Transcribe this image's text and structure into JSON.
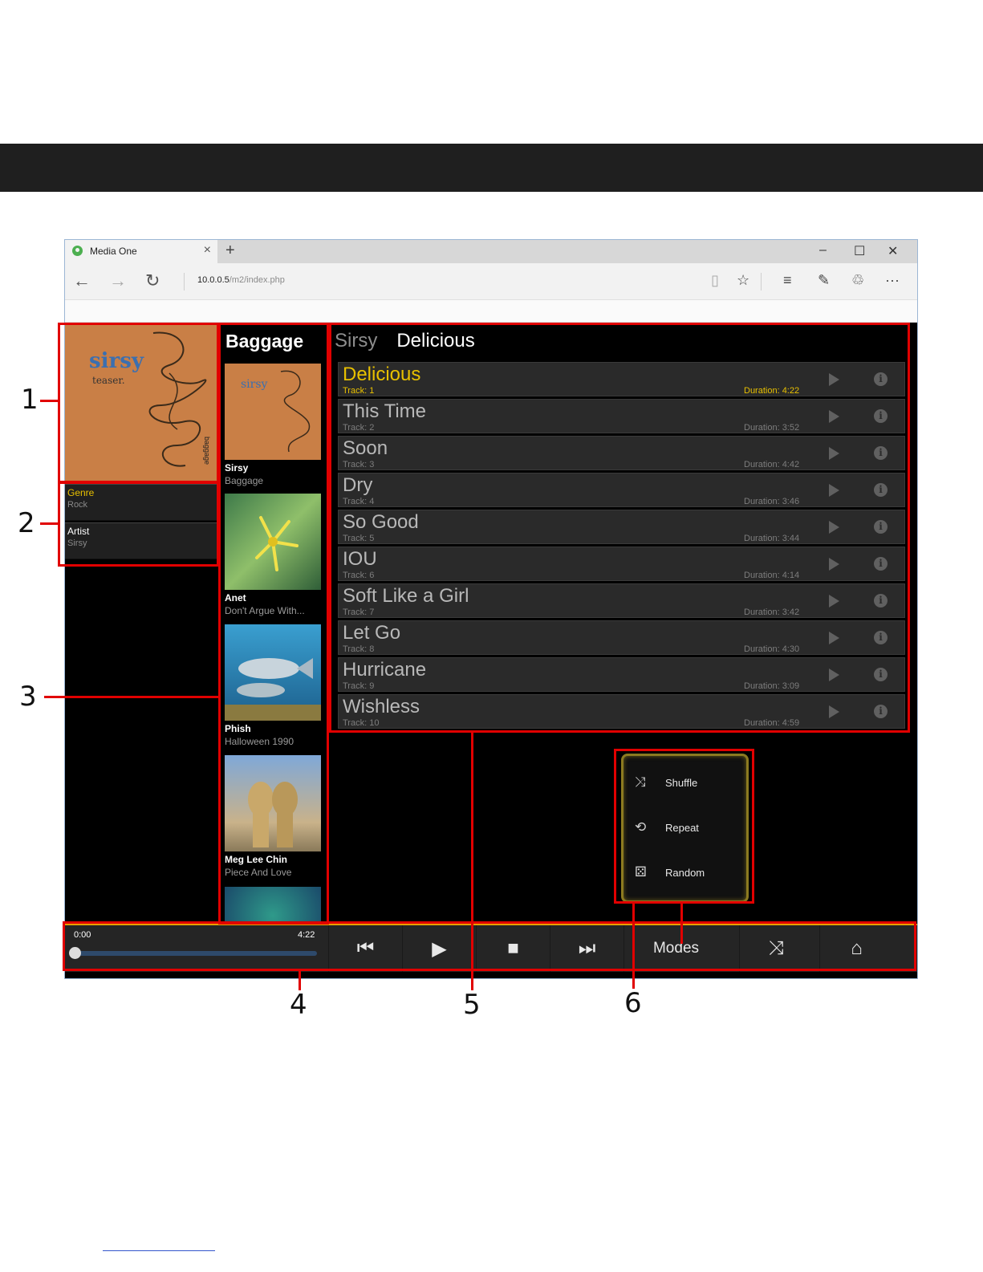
{
  "browser": {
    "tab_title": "Media One",
    "close_glyph": "×",
    "new_tab_glyph": "+",
    "url_host": "10.0.0.5",
    "url_path": "/m2/index.php",
    "window_controls": {
      "minimize": "–",
      "maximize": "☐",
      "close": "✕"
    },
    "nav": {
      "back": "←",
      "forward": "→",
      "refresh": "↻"
    },
    "toolbar_icons": {
      "reading": "▯",
      "favorite": "☆",
      "hub": "≡",
      "note": "✎",
      "share": "♲",
      "more": "···"
    }
  },
  "now_playing": {
    "album_art_text": {
      "band": "sirsy",
      "subtitle": "teaser.",
      "vertical": "baggage"
    },
    "meta": [
      {
        "label": "Genre",
        "value": "Rock",
        "label_color": "#e8c000"
      },
      {
        "label": "Artist",
        "value": "Sirsy",
        "label_color": "#ffffff"
      }
    ]
  },
  "albums": {
    "heading": "Baggage",
    "items": [
      {
        "artist": "Sirsy",
        "album": "Baggage",
        "cover": "sirsy-cover"
      },
      {
        "artist": "Anet",
        "album": "Don't Argue With...",
        "cover": "flower-cover"
      },
      {
        "artist": "Phish",
        "album": "Halloween 1990",
        "cover": "fish-cover"
      },
      {
        "artist": "Meg Lee Chin",
        "album": "Piece And Love",
        "cover": "cheetah-cover"
      }
    ]
  },
  "breadcrumb": {
    "artist": "Sirsy",
    "album": "Delicious"
  },
  "tracks": [
    {
      "title": "Delicious",
      "track": "Track: 1",
      "duration": "Duration: 4:22",
      "active": true
    },
    {
      "title": "This Time",
      "track": "Track: 2",
      "duration": "Duration: 3:52"
    },
    {
      "title": "Soon",
      "track": "Track: 3",
      "duration": "Duration: 4:42"
    },
    {
      "title": "Dry",
      "track": "Track: 4",
      "duration": "Duration: 3:46"
    },
    {
      "title": "So Good",
      "track": "Track: 5",
      "duration": "Duration: 3:44"
    },
    {
      "title": "IOU",
      "track": "Track: 6",
      "duration": "Duration: 4:14"
    },
    {
      "title": "Soft Like a Girl",
      "track": "Track: 7",
      "duration": "Duration: 3:42"
    },
    {
      "title": "Let Go",
      "track": "Track: 8",
      "duration": "Duration: 4:30"
    },
    {
      "title": "Hurricane",
      "track": "Track: 9",
      "duration": "Duration: 3:09"
    },
    {
      "title": "Wishless",
      "track": "Track: 10",
      "duration": "Duration: 4:59"
    }
  ],
  "modes_menu": [
    {
      "label": "Shuffle",
      "icon": "shuffle-icon",
      "glyph": "⤨"
    },
    {
      "label": "Repeat",
      "icon": "repeat-icon",
      "glyph": "⟲"
    },
    {
      "label": "Random",
      "icon": "dice-icon",
      "glyph": "⚄"
    }
  ],
  "player": {
    "elapsed": "0:00",
    "total": "4:22",
    "progress": 0,
    "buttons": [
      {
        "name": "previous-button",
        "glyph": "⏮"
      },
      {
        "name": "play-button",
        "glyph": "▶"
      },
      {
        "name": "stop-button",
        "glyph": "■"
      },
      {
        "name": "next-button",
        "glyph": "⏭"
      },
      {
        "name": "modes-button",
        "label": "Modes"
      },
      {
        "name": "shuffle-button",
        "glyph": "⤨"
      },
      {
        "name": "home-button",
        "glyph": "⌂"
      }
    ]
  },
  "annotations": [
    "1",
    "2",
    "3",
    "4",
    "5",
    "6"
  ],
  "colors": {
    "accent": "#e8c000",
    "annotation": "#e10000",
    "progress_bar": "#e8a000"
  }
}
